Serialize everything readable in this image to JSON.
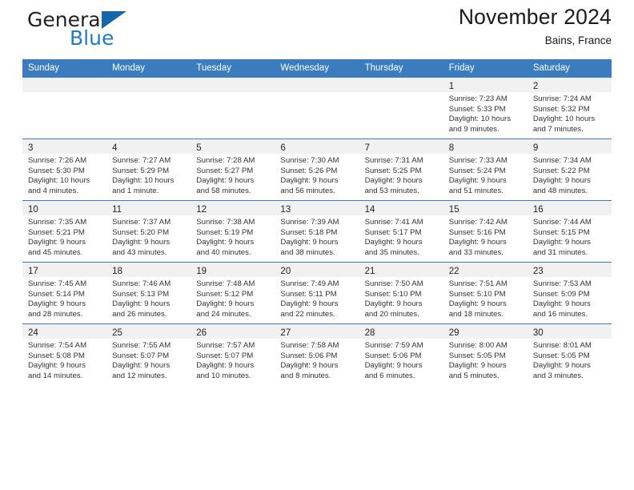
{
  "brand": {
    "name_part1": "General",
    "name_part2": "Blue",
    "triangle_color": "#1566ab",
    "blue_color": "#1f7cc1"
  },
  "header": {
    "title": "November 2024",
    "subtitle": "Bains, France"
  },
  "theme": {
    "header_bg": "#3b7cbe",
    "daynum_bg": "#f1f1f1",
    "grid_line": "#3b7cbe"
  },
  "weekday_headers": [
    "Sunday",
    "Monday",
    "Tuesday",
    "Wednesday",
    "Thursday",
    "Friday",
    "Saturday"
  ],
  "weeks": [
    [
      {
        "day": "",
        "sunrise": "",
        "sunset": "",
        "daylight_line1": "",
        "daylight_line2": ""
      },
      {
        "day": "",
        "sunrise": "",
        "sunset": "",
        "daylight_line1": "",
        "daylight_line2": ""
      },
      {
        "day": "",
        "sunrise": "",
        "sunset": "",
        "daylight_line1": "",
        "daylight_line2": ""
      },
      {
        "day": "",
        "sunrise": "",
        "sunset": "",
        "daylight_line1": "",
        "daylight_line2": ""
      },
      {
        "day": "",
        "sunrise": "",
        "sunset": "",
        "daylight_line1": "",
        "daylight_line2": ""
      },
      {
        "day": "1",
        "sunrise": "Sunrise: 7:23 AM",
        "sunset": "Sunset: 5:33 PM",
        "daylight_line1": "Daylight: 10 hours",
        "daylight_line2": "and 9 minutes."
      },
      {
        "day": "2",
        "sunrise": "Sunrise: 7:24 AM",
        "sunset": "Sunset: 5:32 PM",
        "daylight_line1": "Daylight: 10 hours",
        "daylight_line2": "and 7 minutes."
      }
    ],
    [
      {
        "day": "3",
        "sunrise": "Sunrise: 7:26 AM",
        "sunset": "Sunset: 5:30 PM",
        "daylight_line1": "Daylight: 10 hours",
        "daylight_line2": "and 4 minutes."
      },
      {
        "day": "4",
        "sunrise": "Sunrise: 7:27 AM",
        "sunset": "Sunset: 5:29 PM",
        "daylight_line1": "Daylight: 10 hours",
        "daylight_line2": "and 1 minute."
      },
      {
        "day": "5",
        "sunrise": "Sunrise: 7:28 AM",
        "sunset": "Sunset: 5:27 PM",
        "daylight_line1": "Daylight: 9 hours",
        "daylight_line2": "and 58 minutes."
      },
      {
        "day": "6",
        "sunrise": "Sunrise: 7:30 AM",
        "sunset": "Sunset: 5:26 PM",
        "daylight_line1": "Daylight: 9 hours",
        "daylight_line2": "and 56 minutes."
      },
      {
        "day": "7",
        "sunrise": "Sunrise: 7:31 AM",
        "sunset": "Sunset: 5:25 PM",
        "daylight_line1": "Daylight: 9 hours",
        "daylight_line2": "and 53 minutes."
      },
      {
        "day": "8",
        "sunrise": "Sunrise: 7:33 AM",
        "sunset": "Sunset: 5:24 PM",
        "daylight_line1": "Daylight: 9 hours",
        "daylight_line2": "and 51 minutes."
      },
      {
        "day": "9",
        "sunrise": "Sunrise: 7:34 AM",
        "sunset": "Sunset: 5:22 PM",
        "daylight_line1": "Daylight: 9 hours",
        "daylight_line2": "and 48 minutes."
      }
    ],
    [
      {
        "day": "10",
        "sunrise": "Sunrise: 7:35 AM",
        "sunset": "Sunset: 5:21 PM",
        "daylight_line1": "Daylight: 9 hours",
        "daylight_line2": "and 45 minutes."
      },
      {
        "day": "11",
        "sunrise": "Sunrise: 7:37 AM",
        "sunset": "Sunset: 5:20 PM",
        "daylight_line1": "Daylight: 9 hours",
        "daylight_line2": "and 43 minutes."
      },
      {
        "day": "12",
        "sunrise": "Sunrise: 7:38 AM",
        "sunset": "Sunset: 5:19 PM",
        "daylight_line1": "Daylight: 9 hours",
        "daylight_line2": "and 40 minutes."
      },
      {
        "day": "13",
        "sunrise": "Sunrise: 7:39 AM",
        "sunset": "Sunset: 5:18 PM",
        "daylight_line1": "Daylight: 9 hours",
        "daylight_line2": "and 38 minutes."
      },
      {
        "day": "14",
        "sunrise": "Sunrise: 7:41 AM",
        "sunset": "Sunset: 5:17 PM",
        "daylight_line1": "Daylight: 9 hours",
        "daylight_line2": "and 35 minutes."
      },
      {
        "day": "15",
        "sunrise": "Sunrise: 7:42 AM",
        "sunset": "Sunset: 5:16 PM",
        "daylight_line1": "Daylight: 9 hours",
        "daylight_line2": "and 33 minutes."
      },
      {
        "day": "16",
        "sunrise": "Sunrise: 7:44 AM",
        "sunset": "Sunset: 5:15 PM",
        "daylight_line1": "Daylight: 9 hours",
        "daylight_line2": "and 31 minutes."
      }
    ],
    [
      {
        "day": "17",
        "sunrise": "Sunrise: 7:45 AM",
        "sunset": "Sunset: 5:14 PM",
        "daylight_line1": "Daylight: 9 hours",
        "daylight_line2": "and 28 minutes."
      },
      {
        "day": "18",
        "sunrise": "Sunrise: 7:46 AM",
        "sunset": "Sunset: 5:13 PM",
        "daylight_line1": "Daylight: 9 hours",
        "daylight_line2": "and 26 minutes."
      },
      {
        "day": "19",
        "sunrise": "Sunrise: 7:48 AM",
        "sunset": "Sunset: 5:12 PM",
        "daylight_line1": "Daylight: 9 hours",
        "daylight_line2": "and 24 minutes."
      },
      {
        "day": "20",
        "sunrise": "Sunrise: 7:49 AM",
        "sunset": "Sunset: 5:11 PM",
        "daylight_line1": "Daylight: 9 hours",
        "daylight_line2": "and 22 minutes."
      },
      {
        "day": "21",
        "sunrise": "Sunrise: 7:50 AM",
        "sunset": "Sunset: 5:10 PM",
        "daylight_line1": "Daylight: 9 hours",
        "daylight_line2": "and 20 minutes."
      },
      {
        "day": "22",
        "sunrise": "Sunrise: 7:51 AM",
        "sunset": "Sunset: 5:10 PM",
        "daylight_line1": "Daylight: 9 hours",
        "daylight_line2": "and 18 minutes."
      },
      {
        "day": "23",
        "sunrise": "Sunrise: 7:53 AM",
        "sunset": "Sunset: 5:09 PM",
        "daylight_line1": "Daylight: 9 hours",
        "daylight_line2": "and 16 minutes."
      }
    ],
    [
      {
        "day": "24",
        "sunrise": "Sunrise: 7:54 AM",
        "sunset": "Sunset: 5:08 PM",
        "daylight_line1": "Daylight: 9 hours",
        "daylight_line2": "and 14 minutes."
      },
      {
        "day": "25",
        "sunrise": "Sunrise: 7:55 AM",
        "sunset": "Sunset: 5:07 PM",
        "daylight_line1": "Daylight: 9 hours",
        "daylight_line2": "and 12 minutes."
      },
      {
        "day": "26",
        "sunrise": "Sunrise: 7:57 AM",
        "sunset": "Sunset: 5:07 PM",
        "daylight_line1": "Daylight: 9 hours",
        "daylight_line2": "and 10 minutes."
      },
      {
        "day": "27",
        "sunrise": "Sunrise: 7:58 AM",
        "sunset": "Sunset: 5:06 PM",
        "daylight_line1": "Daylight: 9 hours",
        "daylight_line2": "and 8 minutes."
      },
      {
        "day": "28",
        "sunrise": "Sunrise: 7:59 AM",
        "sunset": "Sunset: 5:06 PM",
        "daylight_line1": "Daylight: 9 hours",
        "daylight_line2": "and 6 minutes."
      },
      {
        "day": "29",
        "sunrise": "Sunrise: 8:00 AM",
        "sunset": "Sunset: 5:05 PM",
        "daylight_line1": "Daylight: 9 hours",
        "daylight_line2": "and 5 minutes."
      },
      {
        "day": "30",
        "sunrise": "Sunrise: 8:01 AM",
        "sunset": "Sunset: 5:05 PM",
        "daylight_line1": "Daylight: 9 hours",
        "daylight_line2": "and 3 minutes."
      }
    ]
  ]
}
